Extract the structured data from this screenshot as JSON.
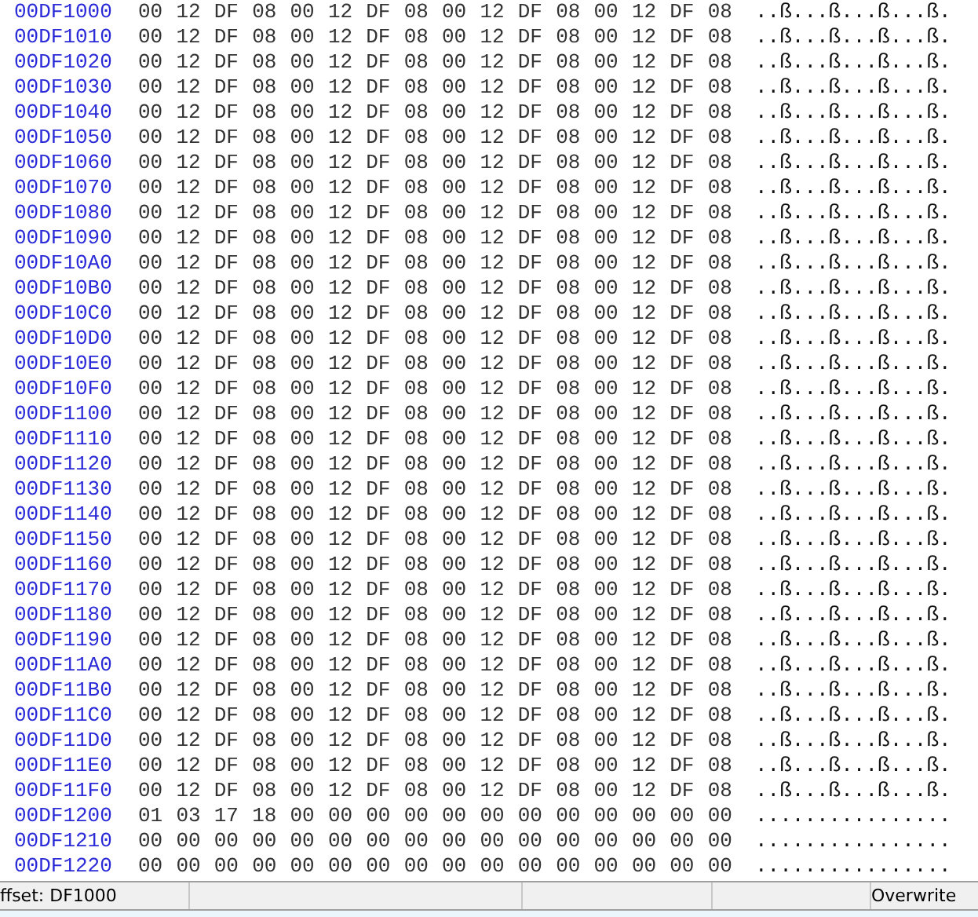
{
  "rows": [
    {
      "offset": "00DF1000",
      "bytes": [
        "00",
        "12",
        "DF",
        "08",
        "00",
        "12",
        "DF",
        "08",
        "00",
        "12",
        "DF",
        "08",
        "00",
        "12",
        "DF",
        "08"
      ],
      "ascii": "..ß...ß...ß...ß."
    },
    {
      "offset": "00DF1010",
      "bytes": [
        "00",
        "12",
        "DF",
        "08",
        "00",
        "12",
        "DF",
        "08",
        "00",
        "12",
        "DF",
        "08",
        "00",
        "12",
        "DF",
        "08"
      ],
      "ascii": "..ß...ß...ß...ß."
    },
    {
      "offset": "00DF1020",
      "bytes": [
        "00",
        "12",
        "DF",
        "08",
        "00",
        "12",
        "DF",
        "08",
        "00",
        "12",
        "DF",
        "08",
        "00",
        "12",
        "DF",
        "08"
      ],
      "ascii": "..ß...ß...ß...ß."
    },
    {
      "offset": "00DF1030",
      "bytes": [
        "00",
        "12",
        "DF",
        "08",
        "00",
        "12",
        "DF",
        "08",
        "00",
        "12",
        "DF",
        "08",
        "00",
        "12",
        "DF",
        "08"
      ],
      "ascii": "..ß...ß...ß...ß."
    },
    {
      "offset": "00DF1040",
      "bytes": [
        "00",
        "12",
        "DF",
        "08",
        "00",
        "12",
        "DF",
        "08",
        "00",
        "12",
        "DF",
        "08",
        "00",
        "12",
        "DF",
        "08"
      ],
      "ascii": "..ß...ß...ß...ß."
    },
    {
      "offset": "00DF1050",
      "bytes": [
        "00",
        "12",
        "DF",
        "08",
        "00",
        "12",
        "DF",
        "08",
        "00",
        "12",
        "DF",
        "08",
        "00",
        "12",
        "DF",
        "08"
      ],
      "ascii": "..ß...ß...ß...ß."
    },
    {
      "offset": "00DF1060",
      "bytes": [
        "00",
        "12",
        "DF",
        "08",
        "00",
        "12",
        "DF",
        "08",
        "00",
        "12",
        "DF",
        "08",
        "00",
        "12",
        "DF",
        "08"
      ],
      "ascii": "..ß...ß...ß...ß."
    },
    {
      "offset": "00DF1070",
      "bytes": [
        "00",
        "12",
        "DF",
        "08",
        "00",
        "12",
        "DF",
        "08",
        "00",
        "12",
        "DF",
        "08",
        "00",
        "12",
        "DF",
        "08"
      ],
      "ascii": "..ß...ß...ß...ß."
    },
    {
      "offset": "00DF1080",
      "bytes": [
        "00",
        "12",
        "DF",
        "08",
        "00",
        "12",
        "DF",
        "08",
        "00",
        "12",
        "DF",
        "08",
        "00",
        "12",
        "DF",
        "08"
      ],
      "ascii": "..ß...ß...ß...ß."
    },
    {
      "offset": "00DF1090",
      "bytes": [
        "00",
        "12",
        "DF",
        "08",
        "00",
        "12",
        "DF",
        "08",
        "00",
        "12",
        "DF",
        "08",
        "00",
        "12",
        "DF",
        "08"
      ],
      "ascii": "..ß...ß...ß...ß."
    },
    {
      "offset": "00DF10A0",
      "bytes": [
        "00",
        "12",
        "DF",
        "08",
        "00",
        "12",
        "DF",
        "08",
        "00",
        "12",
        "DF",
        "08",
        "00",
        "12",
        "DF",
        "08"
      ],
      "ascii": "..ß...ß...ß...ß."
    },
    {
      "offset": "00DF10B0",
      "bytes": [
        "00",
        "12",
        "DF",
        "08",
        "00",
        "12",
        "DF",
        "08",
        "00",
        "12",
        "DF",
        "08",
        "00",
        "12",
        "DF",
        "08"
      ],
      "ascii": "..ß...ß...ß...ß."
    },
    {
      "offset": "00DF10C0",
      "bytes": [
        "00",
        "12",
        "DF",
        "08",
        "00",
        "12",
        "DF",
        "08",
        "00",
        "12",
        "DF",
        "08",
        "00",
        "12",
        "DF",
        "08"
      ],
      "ascii": "..ß...ß...ß...ß."
    },
    {
      "offset": "00DF10D0",
      "bytes": [
        "00",
        "12",
        "DF",
        "08",
        "00",
        "12",
        "DF",
        "08",
        "00",
        "12",
        "DF",
        "08",
        "00",
        "12",
        "DF",
        "08"
      ],
      "ascii": "..ß...ß...ß...ß."
    },
    {
      "offset": "00DF10E0",
      "bytes": [
        "00",
        "12",
        "DF",
        "08",
        "00",
        "12",
        "DF",
        "08",
        "00",
        "12",
        "DF",
        "08",
        "00",
        "12",
        "DF",
        "08"
      ],
      "ascii": "..ß...ß...ß...ß."
    },
    {
      "offset": "00DF10F0",
      "bytes": [
        "00",
        "12",
        "DF",
        "08",
        "00",
        "12",
        "DF",
        "08",
        "00",
        "12",
        "DF",
        "08",
        "00",
        "12",
        "DF",
        "08"
      ],
      "ascii": "..ß...ß...ß...ß."
    },
    {
      "offset": "00DF1100",
      "bytes": [
        "00",
        "12",
        "DF",
        "08",
        "00",
        "12",
        "DF",
        "08",
        "00",
        "12",
        "DF",
        "08",
        "00",
        "12",
        "DF",
        "08"
      ],
      "ascii": "..ß...ß...ß...ß."
    },
    {
      "offset": "00DF1110",
      "bytes": [
        "00",
        "12",
        "DF",
        "08",
        "00",
        "12",
        "DF",
        "08",
        "00",
        "12",
        "DF",
        "08",
        "00",
        "12",
        "DF",
        "08"
      ],
      "ascii": "..ß...ß...ß...ß."
    },
    {
      "offset": "00DF1120",
      "bytes": [
        "00",
        "12",
        "DF",
        "08",
        "00",
        "12",
        "DF",
        "08",
        "00",
        "12",
        "DF",
        "08",
        "00",
        "12",
        "DF",
        "08"
      ],
      "ascii": "..ß...ß...ß...ß."
    },
    {
      "offset": "00DF1130",
      "bytes": [
        "00",
        "12",
        "DF",
        "08",
        "00",
        "12",
        "DF",
        "08",
        "00",
        "12",
        "DF",
        "08",
        "00",
        "12",
        "DF",
        "08"
      ],
      "ascii": "..ß...ß...ß...ß."
    },
    {
      "offset": "00DF1140",
      "bytes": [
        "00",
        "12",
        "DF",
        "08",
        "00",
        "12",
        "DF",
        "08",
        "00",
        "12",
        "DF",
        "08",
        "00",
        "12",
        "DF",
        "08"
      ],
      "ascii": "..ß...ß...ß...ß."
    },
    {
      "offset": "00DF1150",
      "bytes": [
        "00",
        "12",
        "DF",
        "08",
        "00",
        "12",
        "DF",
        "08",
        "00",
        "12",
        "DF",
        "08",
        "00",
        "12",
        "DF",
        "08"
      ],
      "ascii": "..ß...ß...ß...ß."
    },
    {
      "offset": "00DF1160",
      "bytes": [
        "00",
        "12",
        "DF",
        "08",
        "00",
        "12",
        "DF",
        "08",
        "00",
        "12",
        "DF",
        "08",
        "00",
        "12",
        "DF",
        "08"
      ],
      "ascii": "..ß...ß...ß...ß."
    },
    {
      "offset": "00DF1170",
      "bytes": [
        "00",
        "12",
        "DF",
        "08",
        "00",
        "12",
        "DF",
        "08",
        "00",
        "12",
        "DF",
        "08",
        "00",
        "12",
        "DF",
        "08"
      ],
      "ascii": "..ß...ß...ß...ß."
    },
    {
      "offset": "00DF1180",
      "bytes": [
        "00",
        "12",
        "DF",
        "08",
        "00",
        "12",
        "DF",
        "08",
        "00",
        "12",
        "DF",
        "08",
        "00",
        "12",
        "DF",
        "08"
      ],
      "ascii": "..ß...ß...ß...ß."
    },
    {
      "offset": "00DF1190",
      "bytes": [
        "00",
        "12",
        "DF",
        "08",
        "00",
        "12",
        "DF",
        "08",
        "00",
        "12",
        "DF",
        "08",
        "00",
        "12",
        "DF",
        "08"
      ],
      "ascii": "..ß...ß...ß...ß."
    },
    {
      "offset": "00DF11A0",
      "bytes": [
        "00",
        "12",
        "DF",
        "08",
        "00",
        "12",
        "DF",
        "08",
        "00",
        "12",
        "DF",
        "08",
        "00",
        "12",
        "DF",
        "08"
      ],
      "ascii": "..ß...ß...ß...ß."
    },
    {
      "offset": "00DF11B0",
      "bytes": [
        "00",
        "12",
        "DF",
        "08",
        "00",
        "12",
        "DF",
        "08",
        "00",
        "12",
        "DF",
        "08",
        "00",
        "12",
        "DF",
        "08"
      ],
      "ascii": "..ß...ß...ß...ß."
    },
    {
      "offset": "00DF11C0",
      "bytes": [
        "00",
        "12",
        "DF",
        "08",
        "00",
        "12",
        "DF",
        "08",
        "00",
        "12",
        "DF",
        "08",
        "00",
        "12",
        "DF",
        "08"
      ],
      "ascii": "..ß...ß...ß...ß."
    },
    {
      "offset": "00DF11D0",
      "bytes": [
        "00",
        "12",
        "DF",
        "08",
        "00",
        "12",
        "DF",
        "08",
        "00",
        "12",
        "DF",
        "08",
        "00",
        "12",
        "DF",
        "08"
      ],
      "ascii": "..ß...ß...ß...ß."
    },
    {
      "offset": "00DF11E0",
      "bytes": [
        "00",
        "12",
        "DF",
        "08",
        "00",
        "12",
        "DF",
        "08",
        "00",
        "12",
        "DF",
        "08",
        "00",
        "12",
        "DF",
        "08"
      ],
      "ascii": "..ß...ß...ß...ß."
    },
    {
      "offset": "00DF11F0",
      "bytes": [
        "00",
        "12",
        "DF",
        "08",
        "00",
        "12",
        "DF",
        "08",
        "00",
        "12",
        "DF",
        "08",
        "00",
        "12",
        "DF",
        "08"
      ],
      "ascii": "..ß...ß...ß...ß."
    },
    {
      "offset": "00DF1200",
      "bytes": [
        "01",
        "03",
        "17",
        "18",
        "00",
        "00",
        "00",
        "00",
        "00",
        "00",
        "00",
        "00",
        "00",
        "00",
        "00",
        "00"
      ],
      "ascii": "................"
    },
    {
      "offset": "00DF1210",
      "bytes": [
        "00",
        "00",
        "00",
        "00",
        "00",
        "00",
        "00",
        "00",
        "00",
        "00",
        "00",
        "00",
        "00",
        "00",
        "00",
        "00"
      ],
      "ascii": "................"
    },
    {
      "offset": "00DF1220",
      "bytes": [
        "00",
        "00",
        "00",
        "00",
        "00",
        "00",
        "00",
        "00",
        "00",
        "00",
        "00",
        "00",
        "00",
        "00",
        "00",
        "00"
      ],
      "ascii": "................"
    }
  ],
  "status_bar": {
    "offset": "ffset: DF1000",
    "mode": "Overwrite"
  }
}
